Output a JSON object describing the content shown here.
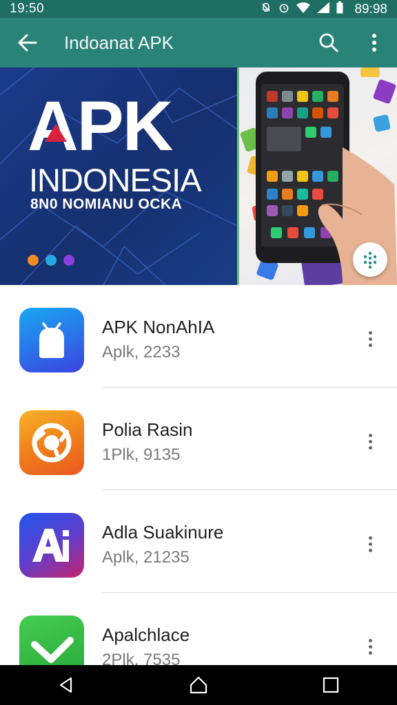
{
  "status_bar": {
    "time": "19:50",
    "right_time": "89:98",
    "icons": [
      "notification-off-icon",
      "alarm-icon",
      "wifi-icon",
      "signal-icon",
      "battery-icon"
    ]
  },
  "app_bar": {
    "title": "Indoanat APK",
    "back_icon": "arrow-left-icon",
    "search_icon": "search-icon",
    "menu_icon": "more-vert-icon"
  },
  "hero": {
    "title": "APK",
    "subtitle": "INDONESIA",
    "tagline": "8N0 NOMIANU OCKA",
    "dots": [
      "#f08a24",
      "#27a9e1",
      "#8b3fd9"
    ],
    "fab_icon": "grid-dots-icon"
  },
  "apps": [
    {
      "name": "APK NonAhIA",
      "sub": "Aplk, 2233",
      "icon": "android-icon",
      "colors": [
        "#1aa0f0",
        "#3a3fe0"
      ]
    },
    {
      "name": "Polia Rasin",
      "sub": "1Plk, 9135",
      "icon": "camera-lens-icon",
      "colors": [
        "#f6a21e",
        "#ee5a24"
      ]
    },
    {
      "name": "Adla Suakinure",
      "sub": "Aplk, 21235",
      "icon": "ai-letter-icon",
      "colors": [
        "#2f57e0",
        "#c0226e"
      ]
    },
    {
      "name": "Apalchlace",
      "sub": "2Plk, 7535",
      "icon": "check-icon",
      "colors": [
        "#39c24a",
        "#1f9a36"
      ]
    }
  ],
  "nav_bar": {
    "icons": [
      "back-triangle-icon",
      "home-icon",
      "recents-square-icon"
    ]
  }
}
